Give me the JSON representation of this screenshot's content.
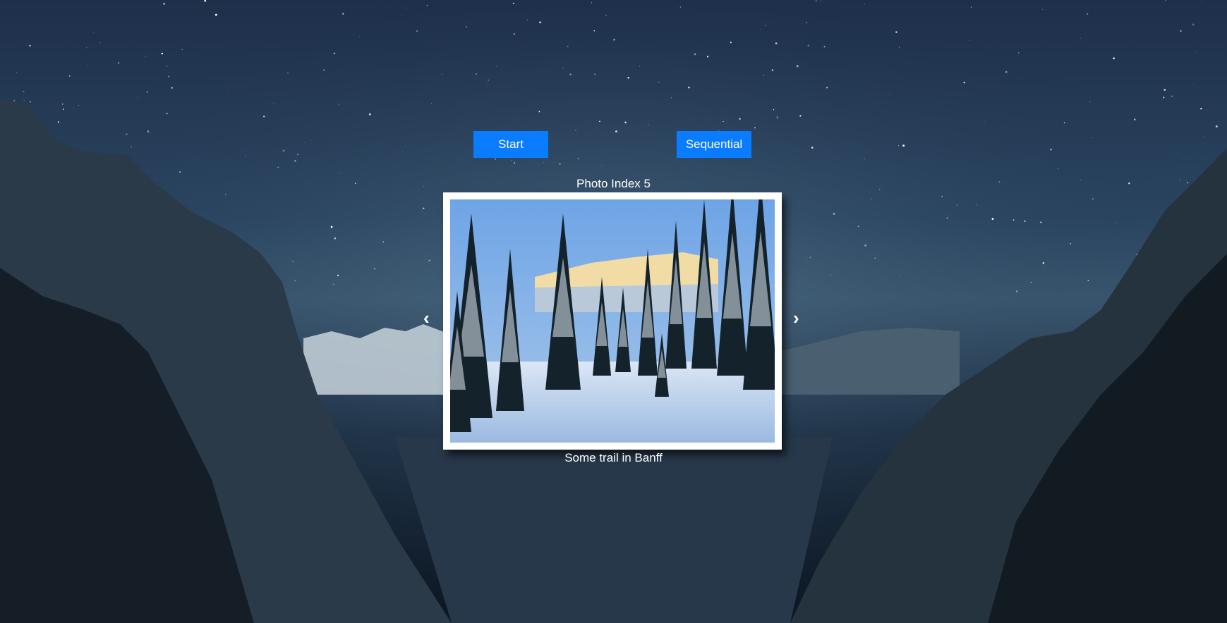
{
  "controls": {
    "start_label": "Start",
    "sequential_label": "Sequential"
  },
  "slideshow": {
    "index_label": "Photo Index 5",
    "prev_arrow": "‹",
    "next_arrow": "›",
    "caption": "Some trail in Banff"
  },
  "colors": {
    "button": "#0a7cff",
    "frame": "#ffffff"
  }
}
